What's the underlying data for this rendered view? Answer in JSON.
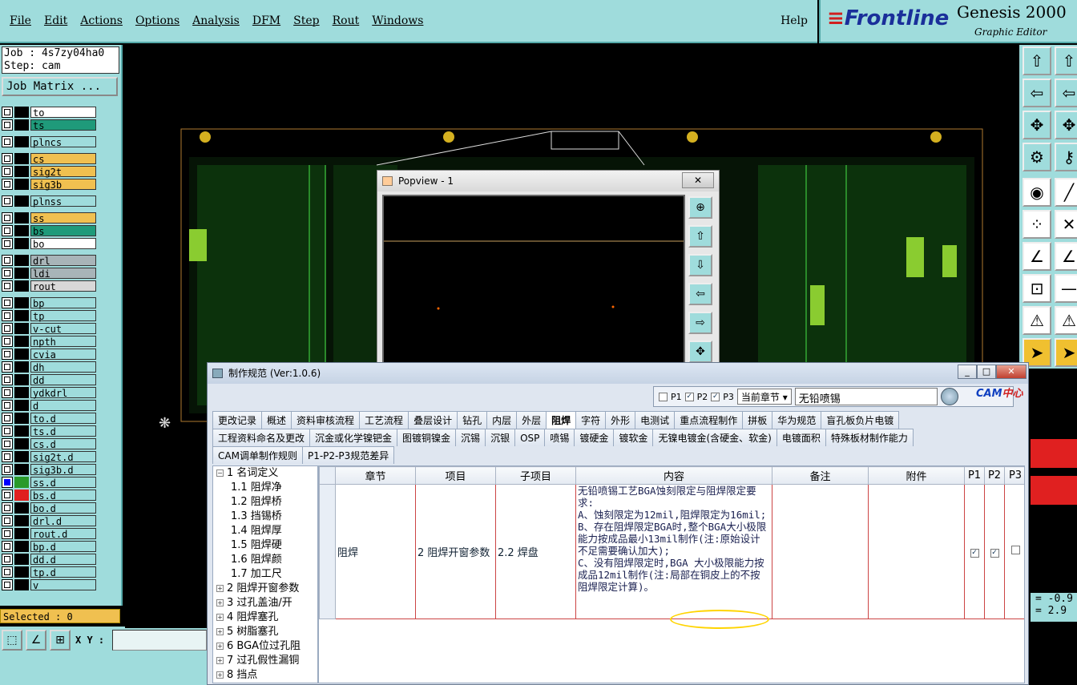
{
  "menubar": {
    "items": [
      "File",
      "Edit",
      "Actions",
      "Options",
      "Analysis",
      "DFM",
      "Step",
      "Rout",
      "Windows"
    ],
    "help": "Help"
  },
  "brand": {
    "logo": "Frontline",
    "product": "Genesis 2000",
    "subtitle": "Graphic Editor"
  },
  "job": {
    "job_line": "Job : 4s7zy04ha0",
    "step_line": "Step: cam",
    "matrix_button": "Job Matrix ..."
  },
  "layers": [
    {
      "name": "to",
      "color": "#ffffff"
    },
    {
      "name": "ts",
      "color": "#1f9a7a"
    },
    {
      "gap": true
    },
    {
      "name": "plncs",
      "color": "#9fdcdc"
    },
    {
      "gap": true
    },
    {
      "name": "cs",
      "color": "#f0c050"
    },
    {
      "name": "sig2t",
      "color": "#f0c050"
    },
    {
      "name": "sig3b",
      "color": "#f0c050"
    },
    {
      "gap": true
    },
    {
      "name": "plnss",
      "color": "#9fdcdc"
    },
    {
      "gap": true
    },
    {
      "name": "ss",
      "color": "#f0c050"
    },
    {
      "name": "bs",
      "color": "#1f9a7a"
    },
    {
      "name": "bo",
      "color": "#ffffff"
    },
    {
      "gap": true
    },
    {
      "name": "drl",
      "color": "#a8b4b8"
    },
    {
      "name": "ldi",
      "color": "#a8b4b8"
    },
    {
      "name": "rout",
      "color": "#d8d8d8"
    },
    {
      "gap": true
    },
    {
      "name": "bp",
      "color": "#9fdcdc"
    },
    {
      "name": "tp",
      "color": "#9fdcdc"
    },
    {
      "name": "v-cut",
      "color": "#9fdcdc"
    },
    {
      "name": "npth",
      "color": "#9fdcdc"
    },
    {
      "name": "cvia",
      "color": "#9fdcdc"
    },
    {
      "name": "dh",
      "color": "#9fdcdc"
    },
    {
      "name": "dd",
      "color": "#9fdcdc"
    },
    {
      "name": "ydkdrl",
      "color": "#9fdcdc"
    },
    {
      "name": "d",
      "color": "#9fdcdc"
    },
    {
      "name": "to.d",
      "color": "#9fdcdc"
    },
    {
      "name": "ts.d",
      "color": "#9fdcdc"
    },
    {
      "name": "cs.d",
      "color": "#9fdcdc"
    },
    {
      "name": "sig2t.d",
      "color": "#9fdcdc"
    },
    {
      "name": "sig3b.d",
      "color": "#9fdcdc"
    },
    {
      "name": "ss.d",
      "color": "#9fdcdc",
      "swatch": "#2a9a2a",
      "checked": true
    },
    {
      "name": "bs.d",
      "color": "#9fdcdc",
      "swatch": "#e02020"
    },
    {
      "name": "bo.d",
      "color": "#9fdcdc"
    },
    {
      "name": "drl.d",
      "color": "#9fdcdc"
    },
    {
      "name": "rout.d",
      "color": "#9fdcdc"
    },
    {
      "name": "bp.d",
      "color": "#9fdcdc"
    },
    {
      "name": "dd.d",
      "color": "#9fdcdc"
    },
    {
      "name": "tp.d",
      "color": "#9fdcdc"
    },
    {
      "name": "v",
      "color": "#9fdcdc"
    }
  ],
  "selected": "Selected : 0",
  "xy_label": "X Y :",
  "popview": {
    "title": "Popview - 1"
  },
  "right_readout": {
    "line1": "= -0.9",
    "line2": "= 2.9"
  },
  "dialog": {
    "title": "制作规范 (Ver:1.0.6)",
    "filters": {
      "p1": "P1",
      "p2": "P2",
      "p3": "P3",
      "p1_checked": false,
      "p2_checked": true,
      "p3_checked": true,
      "scope": "当前章节",
      "search_value": "无铅喷锡"
    },
    "cam_logo_a": "CAM",
    "cam_logo_b": "中心",
    "tabs_row1": [
      "更改记录",
      "概述",
      "资料审核流程",
      "工艺流程",
      "叠层设计",
      "钻孔",
      "内层",
      "外层",
      "阻焊",
      "字符",
      "外形",
      "电测试",
      "重点流程制作",
      "拼板",
      "华为规范",
      "盲孔板负片电镀"
    ],
    "tabs_row1_active": "阻焊",
    "tabs_row2": [
      "工程资料命名及更改",
      "沉金或化学镍钯金",
      "图镀铜镍金",
      "沉锡",
      "沉银",
      "OSP",
      "喷锡",
      "镀硬金",
      "镀软金",
      "无镍电镀金(含硬金、软金)",
      "电镀面积",
      "特殊板材制作能力"
    ],
    "tabs_row3": [
      "CAM调单制作规则",
      "P1-P2-P3规范差异"
    ],
    "tree": [
      {
        "level": 0,
        "pm": "−",
        "text": "1  名词定义"
      },
      {
        "level": 1,
        "text": "1.1  阻焊净"
      },
      {
        "level": 1,
        "text": "1.2  阻焊桥"
      },
      {
        "level": 1,
        "text": "1.3  挡锡桥"
      },
      {
        "level": 1,
        "text": "1.4  阻焊厚"
      },
      {
        "level": 1,
        "text": "1.5  阻焊硬"
      },
      {
        "level": 1,
        "text": "1.6  阻焊颜"
      },
      {
        "level": 1,
        "text": "1.7  加工尺"
      },
      {
        "level": 0,
        "pm": "+",
        "text": "2  阻焊开窗参数"
      },
      {
        "level": 0,
        "pm": "+",
        "text": "3  过孔盖油/开"
      },
      {
        "level": 0,
        "pm": "+",
        "text": "4  阻焊塞孔"
      },
      {
        "level": 0,
        "pm": "+",
        "text": "5  树脂塞孔"
      },
      {
        "level": 0,
        "pm": "+",
        "text": "6  BGA位过孔阻"
      },
      {
        "level": 0,
        "pm": "+",
        "text": "7  过孔假性漏铜"
      },
      {
        "level": 0,
        "pm": "+",
        "text": "8  挡点"
      }
    ],
    "columns": [
      "章节",
      "项目",
      "子项目",
      "内容",
      "备注",
      "附件",
      "P1",
      "P2",
      "P3"
    ],
    "row": {
      "chapter": "阻焊",
      "item": "2 阻焊开窗参数",
      "subitem": "2.2 焊盘",
      "content": "无铅喷锡工艺BGA蚀刻限定与阻焊限定要求:\nA、蚀刻限定为12mil,阻焊限定为16mil;\nB、存在阻焊限定BGA时,整个BGA大小极限能力按成品最小13mil制作(注:原始设计不足需要确认加大);\nC、没有阻焊限定时,BGA 大小极限能力按成品12mil制作(注:局部在铜皮上的不按阻焊限定计算)。",
      "remark": "",
      "attachment": "",
      "p1": true,
      "p2": true,
      "p3": false
    }
  }
}
